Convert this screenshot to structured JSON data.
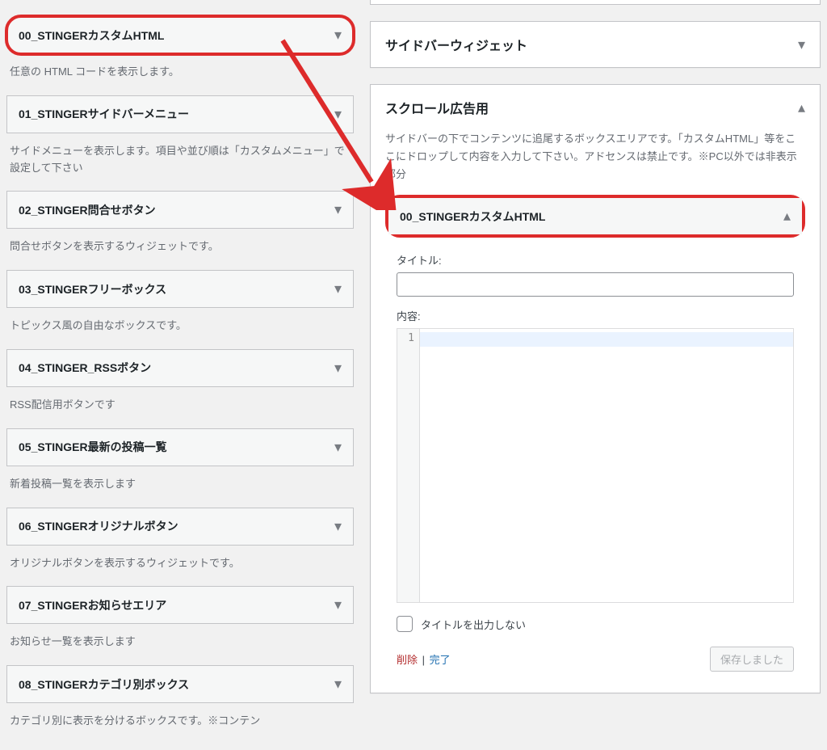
{
  "available_widgets": [
    {
      "title": "00_STINGERカスタムHTML",
      "desc": "任意の HTML コードを表示します。",
      "highlight": true
    },
    {
      "title": "01_STINGERサイドバーメニュー",
      "desc": "サイドメニューを表示します。項目や並び順は「カスタムメニュー」で設定して下さい"
    },
    {
      "title": "02_STINGER問合せボタン",
      "desc": "問合せボタンを表示するウィジェットです。"
    },
    {
      "title": "03_STINGERフリーボックス",
      "desc": "トピックス風の自由なボックスです。"
    },
    {
      "title": "04_STINGER_RSSボタン",
      "desc": "RSS配信用ボタンです"
    },
    {
      "title": "05_STINGER最新の投稿一覧",
      "desc": "新着投稿一覧を表示します"
    },
    {
      "title": "06_STINGERオリジナルボタン",
      "desc": "オリジナルボタンを表示するウィジェットです。"
    },
    {
      "title": "07_STINGERお知らせエリア",
      "desc": "お知らせ一覧を表示します"
    },
    {
      "title": "08_STINGERカテゴリ別ボックス",
      "desc": "カテゴリ別に表示を分けるボックスです。※コンテン"
    }
  ],
  "sidebar_panel": {
    "title": "サイドバーウィジェット"
  },
  "scroll_panel": {
    "title": "スクロール広告用",
    "desc": "サイドバーの下でコンテンツに追尾するボックスエリアです。「カスタムHTML」等をここにドロップして内容を入力して下さい。アドセンスは禁止です。※PC以外では非表示部分",
    "widget_title": "00_STINGERカスタムHTML",
    "label_title": "タイトル:",
    "label_content": "内容:",
    "line_no": "1",
    "checkbox_label": "タイトルを出力しない",
    "delete": "削除",
    "done": "完了",
    "saved": "保存しました"
  }
}
